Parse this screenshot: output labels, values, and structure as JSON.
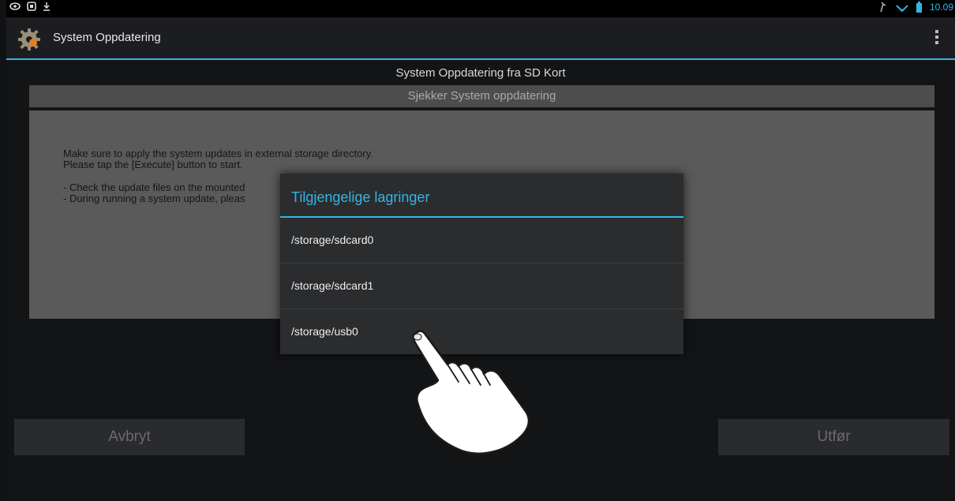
{
  "status_bar": {
    "left_icons": [
      "eye-icon",
      "screenshot-icon",
      "download-icon"
    ],
    "right_icons": [
      "gesture-icon",
      "wifi-icon",
      "battery-icon"
    ],
    "time": "10.09"
  },
  "action_bar": {
    "title": "System Oppdatering",
    "app_icon": "gear-icon",
    "overflow_icon": "overflow-menu-icon"
  },
  "screen": {
    "title": "System Oppdatering fra SD Kort",
    "subheader": "Sjekker System oppdatering",
    "instructions": [
      "Make sure to apply the system updates in external storage directory.",
      "Please tap the [Execute] button to start.",
      "",
      "- Check the update files on the mounted",
      "- During running a system update, pleas"
    ]
  },
  "buttons": {
    "cancel": "Avbryt",
    "execute": "Utfør"
  },
  "dialog": {
    "title": "Tilgjengelige lagringer",
    "items": [
      "/storage/sdcard0",
      "/storage/sdcard1",
      "/storage/usb0"
    ]
  },
  "colors": {
    "accent": "#33b5e5",
    "background": "#131416",
    "panel": "#5a5a5a",
    "dialog": "#2b2c2e"
  }
}
